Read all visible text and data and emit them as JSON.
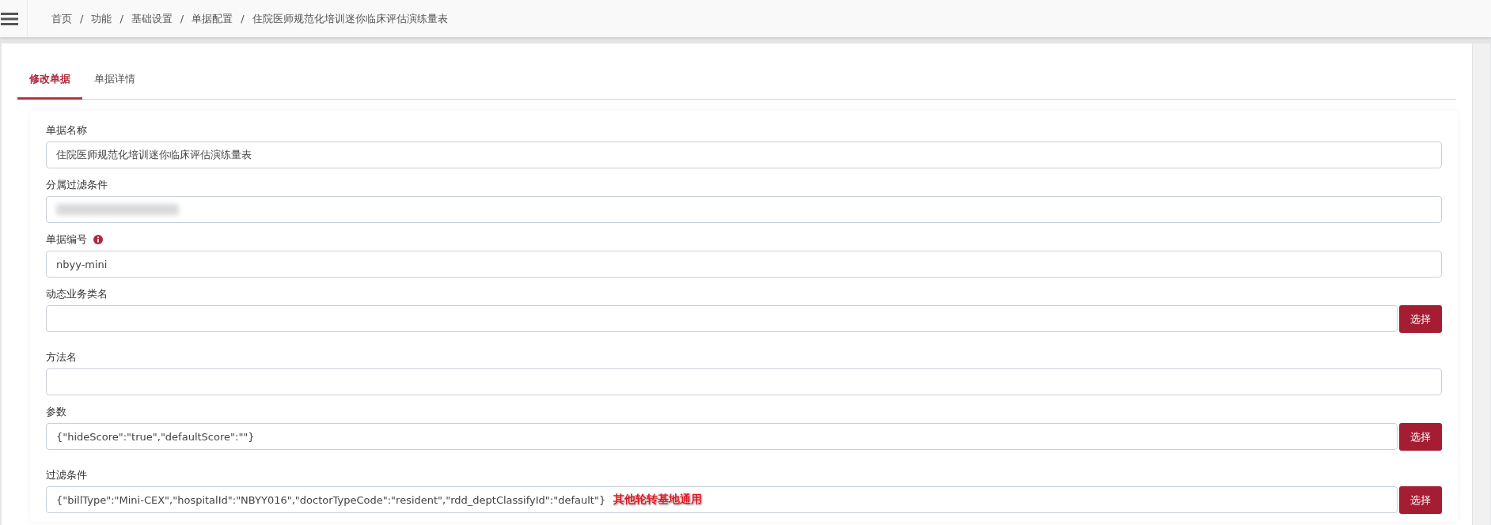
{
  "breadcrumb": [
    "首页",
    "功能",
    "基础设置",
    "单据配置",
    "住院医师规范化培训迷你临床评估演练量表"
  ],
  "breadcrumb_separator": "/",
  "tabs": [
    {
      "label": "修改单据",
      "selected": true
    },
    {
      "label": "单据详情",
      "selected": false
    }
  ],
  "fields": [
    {
      "kind": "text",
      "label": "单据名称",
      "value": "住院医师规范化培训迷你临床评估演练量表"
    },
    {
      "kind": "redacted",
      "label": "分属过滤条件"
    },
    {
      "kind": "text",
      "label": "单据编号",
      "info_icon": true,
      "value": "nbyy-mini"
    },
    {
      "kind": "select",
      "label": "动态业务类名",
      "button": "选择"
    },
    {
      "kind": "text",
      "label": "方法名"
    },
    {
      "kind": "select",
      "label": "参数",
      "value": "{\"hideScore\":\"true\",\"defaultScore\":\"\"}",
      "button": "选择"
    },
    {
      "kind": "select",
      "label": "过滤条件",
      "value": "{\"billType\":\"Mini-CEX\",\"hospitalId\":\"NBYY016\",\"doctorTypeCode\":\"resident\",\"rdd_deptClassifyId\":\"default\"}",
      "annotation": "其他轮转基地通用",
      "button": "选择"
    }
  ]
}
